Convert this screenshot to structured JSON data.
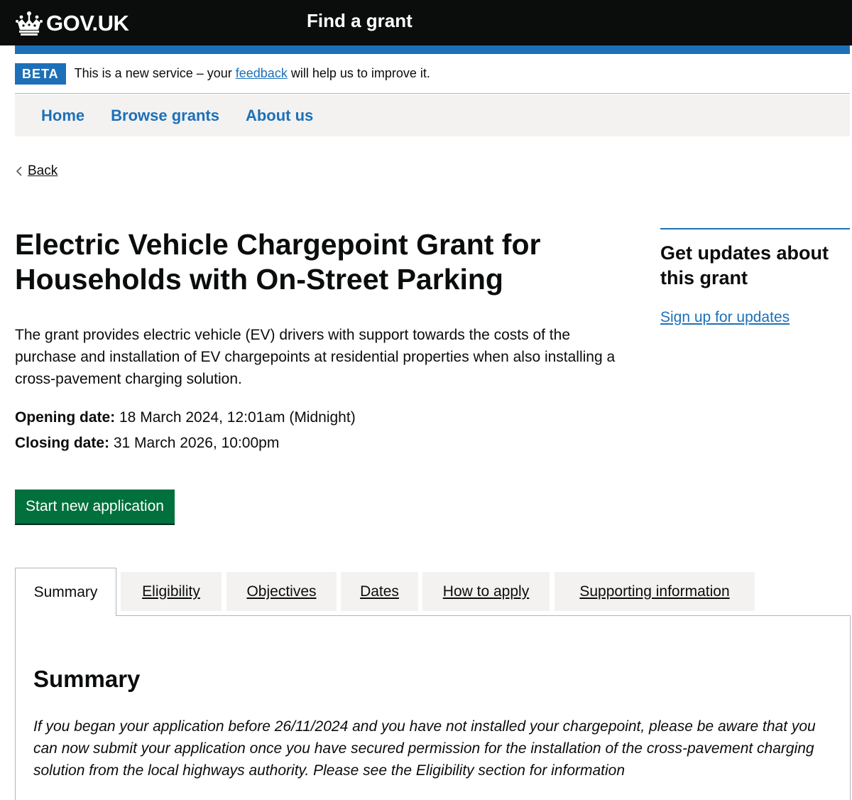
{
  "header": {
    "logo_text": "GOV.UK",
    "service_name": "Find a grant",
    "colors": {
      "background": "#0b0c0c",
      "accent": "#1d70b8"
    }
  },
  "phase_banner": {
    "tag": "BETA",
    "text_before": "This is a new service – your ",
    "link_text": "feedback",
    "text_after": " will help us to improve it."
  },
  "nav": {
    "items": [
      {
        "label": "Home"
      },
      {
        "label": "Browse grants"
      },
      {
        "label": "About us"
      }
    ]
  },
  "back_link": {
    "label": "Back"
  },
  "grant": {
    "title_line1": "Electric Vehicle Chargepoint Grant for",
    "title_line2": "Households with On-Street Parking",
    "description": "The grant provides electric vehicle (EV) drivers with support towards the costs of the purchase and installation of EV chargepoints at residential properties when also installing a cross-pavement charging solution.",
    "opening_label": "Opening date:",
    "opening_value": " 18 March 2024, 12:01am (Midnight)",
    "closing_label": "Closing date:",
    "closing_value": " 31 March 2026, 10:00pm",
    "start_button": "Start new application",
    "start_button_color": "#00703c"
  },
  "sidebar": {
    "heading_line1": "Get updates about",
    "heading_line2": "this grant",
    "link": "Sign up for updates"
  },
  "tabs": {
    "items": [
      {
        "label": "Summary",
        "active": true
      },
      {
        "label": "Eligibility"
      },
      {
        "label": "Objectives"
      },
      {
        "label": "Dates"
      },
      {
        "label": "How to apply"
      },
      {
        "label": "Supporting information"
      }
    ]
  },
  "panel": {
    "heading": "Summary",
    "text": "If you began your application before 26/11/2024 and you have not installed your chargepoint, please be aware that you can now submit your application once you have secured permission for the installation of the cross-pavement charging solution from the local highways authority. Please see the Eligibility section for information"
  }
}
